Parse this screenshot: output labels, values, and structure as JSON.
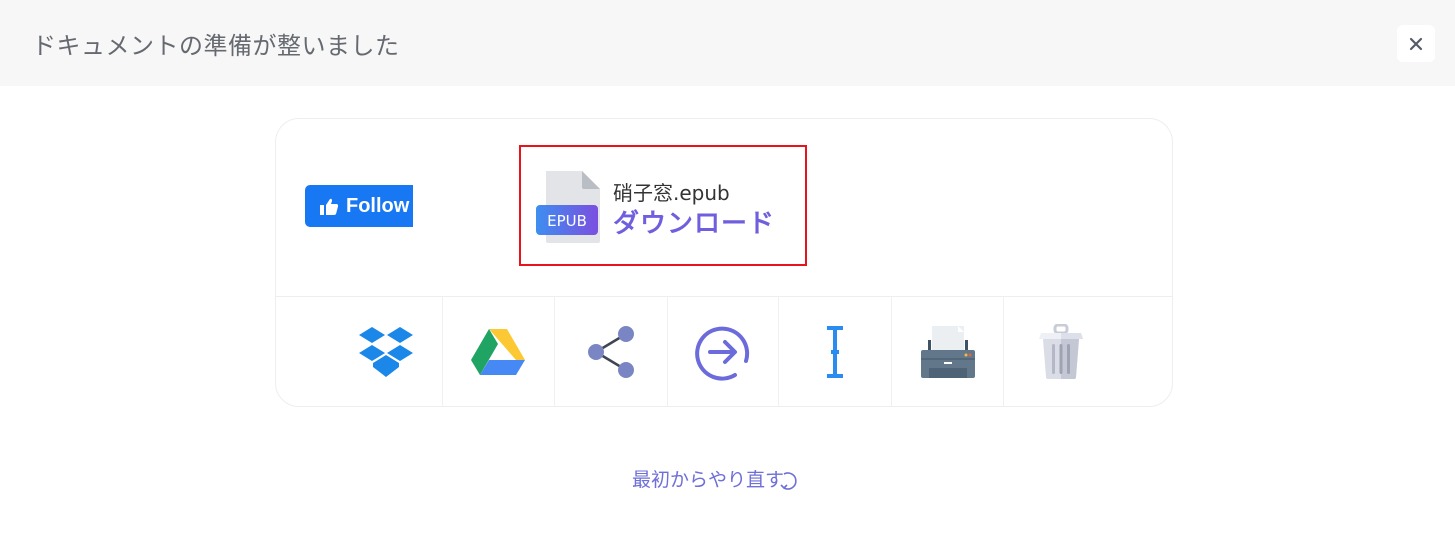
{
  "header": {
    "title": "ドキュメントの準備が整いました",
    "close_icon": "close-icon"
  },
  "card": {
    "follow_button": {
      "label": "Follow",
      "icon": "thumbs-up-icon",
      "color": "#1877f2"
    },
    "download": {
      "file_type_badge": "EPUB",
      "file_name": "硝子窓.epub",
      "label": "ダウンロード",
      "highlight_color": "#e8141c",
      "accent_color": "#6f5fde"
    },
    "actions": [
      {
        "name": "dropbox",
        "icon": "dropbox-icon"
      },
      {
        "name": "google-drive",
        "icon": "google-drive-icon"
      },
      {
        "name": "share",
        "icon": "share-icon"
      },
      {
        "name": "convert",
        "icon": "arrow-circle-right-icon"
      },
      {
        "name": "edit-text",
        "icon": "text-cursor-icon"
      },
      {
        "name": "print",
        "icon": "printer-icon"
      },
      {
        "name": "delete",
        "icon": "trash-icon"
      }
    ]
  },
  "footer": {
    "restart_label": "最初からやり直す",
    "restart_icon": "refresh-icon"
  }
}
